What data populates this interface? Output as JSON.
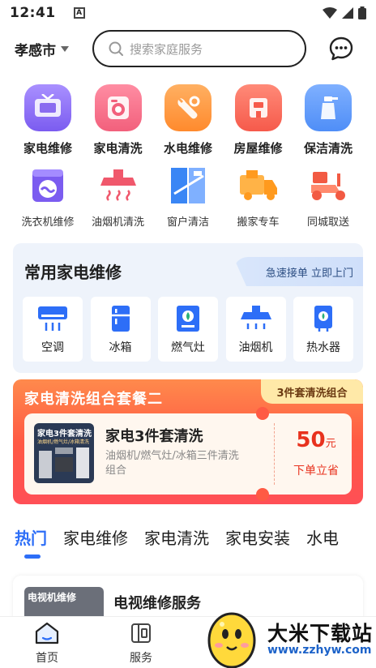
{
  "status_bar": {
    "time": "12:41",
    "badge": "A"
  },
  "header": {
    "city": "孝感市",
    "search_placeholder": "搜索家庭服务"
  },
  "primary_services": [
    {
      "label": "家电维修",
      "icon": "tv-repair-icon",
      "color": "#8a6bf0"
    },
    {
      "label": "家电清洗",
      "icon": "washer-clean-icon",
      "color": "#f2607c"
    },
    {
      "label": "水电维修",
      "icon": "wrench-icon",
      "color": "#ff8a2d"
    },
    {
      "label": "房屋维修",
      "icon": "house-repair-icon",
      "color": "#f65a4b"
    },
    {
      "label": "保洁清洗",
      "icon": "spray-bottle-icon",
      "color": "#4f8ef7"
    }
  ],
  "secondary_services": [
    {
      "label": "洗衣机维修",
      "icon": "washing-machine-icon",
      "color": "#7b5cf0"
    },
    {
      "label": "油烟机清洗",
      "icon": "range-hood-icon",
      "color": "#f0586c"
    },
    {
      "label": "窗户清洁",
      "icon": "window-icon",
      "color": "#3a86f5"
    },
    {
      "label": "搬家专车",
      "icon": "moving-truck-icon",
      "color": "#ff9a1e"
    },
    {
      "label": "同城取送",
      "icon": "delivery-scooter-icon",
      "color": "#f25a43"
    }
  ],
  "repair_section": {
    "title": "常用家电维修",
    "tag": "急速接单 立即上门",
    "items": [
      {
        "label": "空调",
        "icon": "air-conditioner-icon"
      },
      {
        "label": "冰箱",
        "icon": "fridge-icon"
      },
      {
        "label": "燃气灶",
        "icon": "gas-stove-icon"
      },
      {
        "label": "油烟机",
        "icon": "range-hood-icon"
      },
      {
        "label": "热水器",
        "icon": "water-heater-icon"
      }
    ],
    "icon_color": "#2d6ef7"
  },
  "promo": {
    "title": "家电清洗组合套餐二",
    "badge": "3件套清洗组合",
    "thumb_title": "家电3件套清洗",
    "thumb_sub": "油烟机/燃气灶/冰箱清洗",
    "product_title": "家电3件套清洗",
    "product_desc": "油烟机/燃气灶/冰箱三件清洗组合",
    "price": "50",
    "price_unit": "元",
    "cta": "下单立省"
  },
  "tabs": [
    "热门",
    "家电维修",
    "家电清洗",
    "家电安装",
    "水电"
  ],
  "active_tab": 0,
  "list_item": {
    "thumb_text": "电视机维修",
    "title": "电视维修服务"
  },
  "bottom_nav": [
    {
      "label": "首页",
      "icon": "home-icon"
    },
    {
      "label": "服务",
      "icon": "service-icon"
    }
  ],
  "watermark": {
    "title": "大米下载站",
    "url": "www.zzhyw.com"
  },
  "colors": {
    "accent": "#2d6ef7",
    "promo_red": "#ff5a44",
    "price_red": "#e8321e"
  }
}
